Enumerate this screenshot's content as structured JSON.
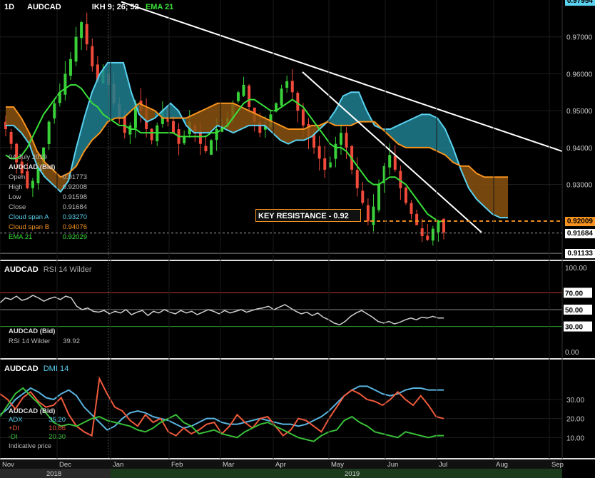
{
  "header": {
    "timeframe": "1D",
    "symbol": "AUDCAD",
    "ind1": "IKH 9; 26; 52",
    "ind2": "EMA 21"
  },
  "tooltip": {
    "date": "04 July 2019",
    "instrument": "AUDCAD (Bid)",
    "rows": [
      {
        "k": "Open",
        "v": "0.91773",
        "color": "#bbbbbb"
      },
      {
        "k": "High",
        "v": "0.92008",
        "color": "#bbbbbb"
      },
      {
        "k": "Low",
        "v": "0.91598",
        "color": "#bbbbbb"
      },
      {
        "k": "Close",
        "v": "0.91684",
        "color": "#bbbbbb"
      },
      {
        "k": "Cloud span A",
        "v": "0.93270",
        "color": "#5ad2f0"
      },
      {
        "k": "Cloud span B",
        "v": "0.94076",
        "color": "#f7931e"
      },
      {
        "k": "EMA 21",
        "v": "0.92029",
        "color": "#39e039"
      }
    ]
  },
  "annotation": "KEY RESISTANCE - 0.92",
  "price_badges": [
    {
      "text": "0.92009",
      "value": 0.92009,
      "bg": "#f7931e",
      "fg": "#000"
    },
    {
      "text": "0.91684",
      "value": 0.91684,
      "bg": "#ffffff",
      "fg": "#000"
    },
    {
      "text": "0.91133",
      "value": 0.91133,
      "bg": "#ffffff",
      "fg": "#000"
    },
    {
      "text": "0.97954",
      "value": 0.97954,
      "bg": "#5ad2f0",
      "fg": "#000"
    }
  ],
  "rsi": {
    "title_sym": "AUDCAD",
    "title_ind": "RSI 14 Wilder",
    "tip_inst": "AUDCAD (Bid)",
    "tip_k": "RSI 14 Wilder",
    "tip_v": "39.92",
    "highlight": [
      "70.00",
      "50.00",
      "30.00"
    ]
  },
  "dmi": {
    "title_sym": "AUDCAD",
    "title_ind": "DMI 14",
    "tip_inst": "AUDCAD (Bid)",
    "rows": [
      {
        "k": "ADX",
        "v": "35.20",
        "color": "#5ad2f0"
      },
      {
        "k": "+DI",
        "v": "10.86",
        "color": "#f05a3c"
      },
      {
        "k": "-DI",
        "v": "20.30",
        "color": "#39c039"
      }
    ],
    "footer": "Indicative price"
  },
  "colors": {
    "bull": "#39d039",
    "bear": "#f04a3a",
    "spanA": "#5ad2f0",
    "spanB": "#f7931e",
    "cloudBull": "#1f7f8f",
    "cloudBear": "#8a5210",
    "ema": "#39e039",
    "white": "#ffffff"
  },
  "chart_data": [
    {
      "type": "candlestick",
      "title": "AUDCAD 1D IKH 9; 26; 52 EMA 21",
      "ylim": [
        0.91,
        0.98
      ],
      "y_ticks": [
        "0.97000",
        "0.96000",
        "0.95000",
        "0.94000",
        "0.93000"
      ],
      "x_ticks": [
        "Nov",
        "Dec",
        "Jan",
        "Feb",
        "Mar",
        "Apr",
        "May",
        "Jun",
        "Jul",
        "Aug",
        "Sep"
      ],
      "year_labels": [
        "2018",
        "2019"
      ],
      "close_series": [
        0.945,
        0.941,
        0.936,
        0.933,
        0.929,
        0.931,
        0.936,
        0.94,
        0.947,
        0.952,
        0.955,
        0.96,
        0.964,
        0.97,
        0.974,
        0.968,
        0.962,
        0.958,
        0.961,
        0.957,
        0.952,
        0.948,
        0.944,
        0.946,
        0.952,
        0.95,
        0.945,
        0.942,
        0.946,
        0.95,
        0.947,
        0.944,
        0.941,
        0.943,
        0.947,
        0.944,
        0.941,
        0.939,
        0.942,
        0.945,
        0.946,
        0.948,
        0.952,
        0.955,
        0.957,
        0.951,
        0.947,
        0.944,
        0.946,
        0.949,
        0.952,
        0.956,
        0.958,
        0.955,
        0.95,
        0.946,
        0.943,
        0.94,
        0.937,
        0.934,
        0.936,
        0.941,
        0.944,
        0.94,
        0.934,
        0.929,
        0.925,
        0.92,
        0.924,
        0.93,
        0.935,
        0.938,
        0.934,
        0.929,
        0.925,
        0.922,
        0.919,
        0.916,
        0.915,
        0.918,
        0.92,
        0.917
      ],
      "ema21": [
        0.938,
        0.937,
        0.937,
        0.938,
        0.94,
        0.943,
        0.946,
        0.949,
        0.951,
        0.953,
        0.955,
        0.956,
        0.957,
        0.957,
        0.956,
        0.954,
        0.952,
        0.951,
        0.949,
        0.948,
        0.947,
        0.946,
        0.946,
        0.945,
        0.945,
        0.944,
        0.944,
        0.944,
        0.944,
        0.944,
        0.944,
        0.944,
        0.943,
        0.943,
        0.943,
        0.943,
        0.943,
        0.943,
        0.944,
        0.944,
        0.945,
        0.946,
        0.948,
        0.95,
        0.952,
        0.953,
        0.953,
        0.952,
        0.951,
        0.95,
        0.95,
        0.951,
        0.952,
        0.953,
        0.952,
        0.951,
        0.949,
        0.947,
        0.945,
        0.943,
        0.941,
        0.94,
        0.94,
        0.939,
        0.937,
        0.935,
        0.933,
        0.931,
        0.93,
        0.93,
        0.931,
        0.932,
        0.932,
        0.931,
        0.93,
        0.928,
        0.926,
        0.924,
        0.922,
        0.921,
        0.92,
        0.92
      ],
      "span_a": [
        0.946,
        0.946,
        0.944,
        0.941,
        0.935,
        0.932,
        0.93,
        0.928,
        0.931,
        0.94,
        0.948,
        0.955,
        0.96,
        0.963,
        0.963,
        0.963,
        0.955,
        0.949,
        0.947,
        0.948,
        0.95,
        0.952,
        0.95,
        0.946,
        0.944,
        0.944,
        0.944,
        0.946,
        0.945,
        0.944,
        0.945,
        0.946,
        0.946,
        0.946,
        0.944,
        0.942,
        0.941,
        0.942,
        0.942,
        0.943,
        0.945,
        0.947,
        0.95,
        0.954,
        0.955,
        0.955,
        0.95,
        0.946,
        0.945,
        0.945,
        0.946,
        0.947,
        0.948,
        0.949,
        0.949,
        0.948,
        0.945,
        0.94,
        0.934,
        0.929,
        0.926,
        0.924,
        0.922,
        0.921,
        0.921
      ],
      "span_b": [
        0.951,
        0.951,
        0.948,
        0.944,
        0.939,
        0.936,
        0.934,
        0.932,
        0.933,
        0.935,
        0.939,
        0.942,
        0.944,
        0.947,
        0.948,
        0.948,
        0.95,
        0.952,
        0.951,
        0.95,
        0.948,
        0.948,
        0.948,
        0.948,
        0.949,
        0.95,
        0.951,
        0.952,
        0.952,
        0.952,
        0.951,
        0.95,
        0.949,
        0.948,
        0.947,
        0.946,
        0.945,
        0.945,
        0.945,
        0.946,
        0.946,
        0.947,
        0.946,
        0.946,
        0.946,
        0.947,
        0.947,
        0.947,
        0.945,
        0.943,
        0.941,
        0.94,
        0.94,
        0.94,
        0.94,
        0.939,
        0.938,
        0.936,
        0.935,
        0.935,
        0.933,
        0.932,
        0.932,
        0.932,
        0.932
      ],
      "key_resistance": 0.92,
      "trendline_1": [
        [
          0.9795,
          0
        ],
        [
          0.94,
          1
        ]
      ],
      "trendline_2": [
        [
          0.96,
          0
        ],
        [
          0.917,
          1
        ]
      ]
    },
    {
      "type": "line",
      "title": "AUDCAD RSI 14 Wilder",
      "ylim": [
        0,
        100
      ],
      "y_ticks": [
        "100.00",
        "70.00",
        "50.00",
        "30.00",
        "0.00"
      ],
      "series": [
        {
          "name": "RSI 14 Wilder",
          "values": [
            58,
            64,
            62,
            66,
            61,
            63,
            67,
            64,
            60,
            63,
            65,
            62,
            66,
            64,
            54,
            50,
            52,
            48,
            47,
            49,
            45,
            48,
            46,
            50,
            44,
            47,
            49,
            43,
            48,
            46,
            50,
            47,
            45,
            49,
            46,
            48,
            44,
            47,
            50,
            48,
            45,
            49,
            46,
            48,
            50,
            47,
            49,
            51,
            52,
            54,
            50,
            53,
            56,
            52,
            48,
            45,
            47,
            43,
            46,
            41,
            38,
            34,
            32,
            36,
            42,
            46,
            49,
            45,
            41,
            36,
            34,
            36,
            33,
            35,
            38,
            40,
            38,
            41,
            40,
            42,
            40,
            40
          ]
        }
      ]
    },
    {
      "type": "line",
      "title": "AUDCAD DMI 14",
      "ylim": [
        0,
        45
      ],
      "y_ticks": [
        "30.00",
        "20.00",
        "10.00"
      ],
      "series": [
        {
          "name": "ADX",
          "values": [
            22,
            25,
            30,
            33,
            36,
            34,
            31,
            30,
            33,
            35,
            32,
            26,
            22,
            18,
            14,
            16,
            20,
            23,
            24,
            23,
            21,
            20,
            19,
            17,
            15,
            16,
            18,
            20,
            20,
            18,
            17,
            17,
            18,
            19,
            20,
            19,
            18,
            17,
            17,
            16,
            17,
            19,
            21,
            24,
            28,
            32,
            35,
            37,
            37,
            35,
            33,
            32,
            33,
            35,
            36,
            36,
            35,
            35,
            35
          ]
        },
        {
          "name": "+DI",
          "values": [
            33,
            30,
            25,
            31,
            34,
            29,
            26,
            27,
            31,
            22,
            16,
            13,
            11,
            41,
            33,
            26,
            24,
            19,
            16,
            22,
            18,
            20,
            13,
            11,
            15,
            12,
            14,
            17,
            18,
            12,
            16,
            22,
            18,
            15,
            20,
            21,
            16,
            11,
            14,
            20,
            19,
            16,
            13,
            20,
            26,
            32,
            35,
            33,
            30,
            29,
            27,
            30,
            34,
            30,
            27,
            32,
            27,
            21,
            20
          ]
        },
        {
          "name": "-DI",
          "values": [
            21,
            27,
            33,
            36,
            32,
            28,
            23,
            18,
            16,
            17,
            16,
            18,
            20,
            21,
            19,
            18,
            17,
            16,
            14,
            13,
            15,
            18,
            20,
            22,
            18,
            16,
            12,
            13,
            14,
            12,
            11,
            10,
            13,
            15,
            17,
            18,
            16,
            14,
            12,
            10,
            9,
            8,
            11,
            13,
            14,
            19,
            21,
            18,
            16,
            13,
            12,
            11,
            10,
            13,
            12,
            11,
            10,
            11,
            11
          ]
        }
      ]
    }
  ]
}
